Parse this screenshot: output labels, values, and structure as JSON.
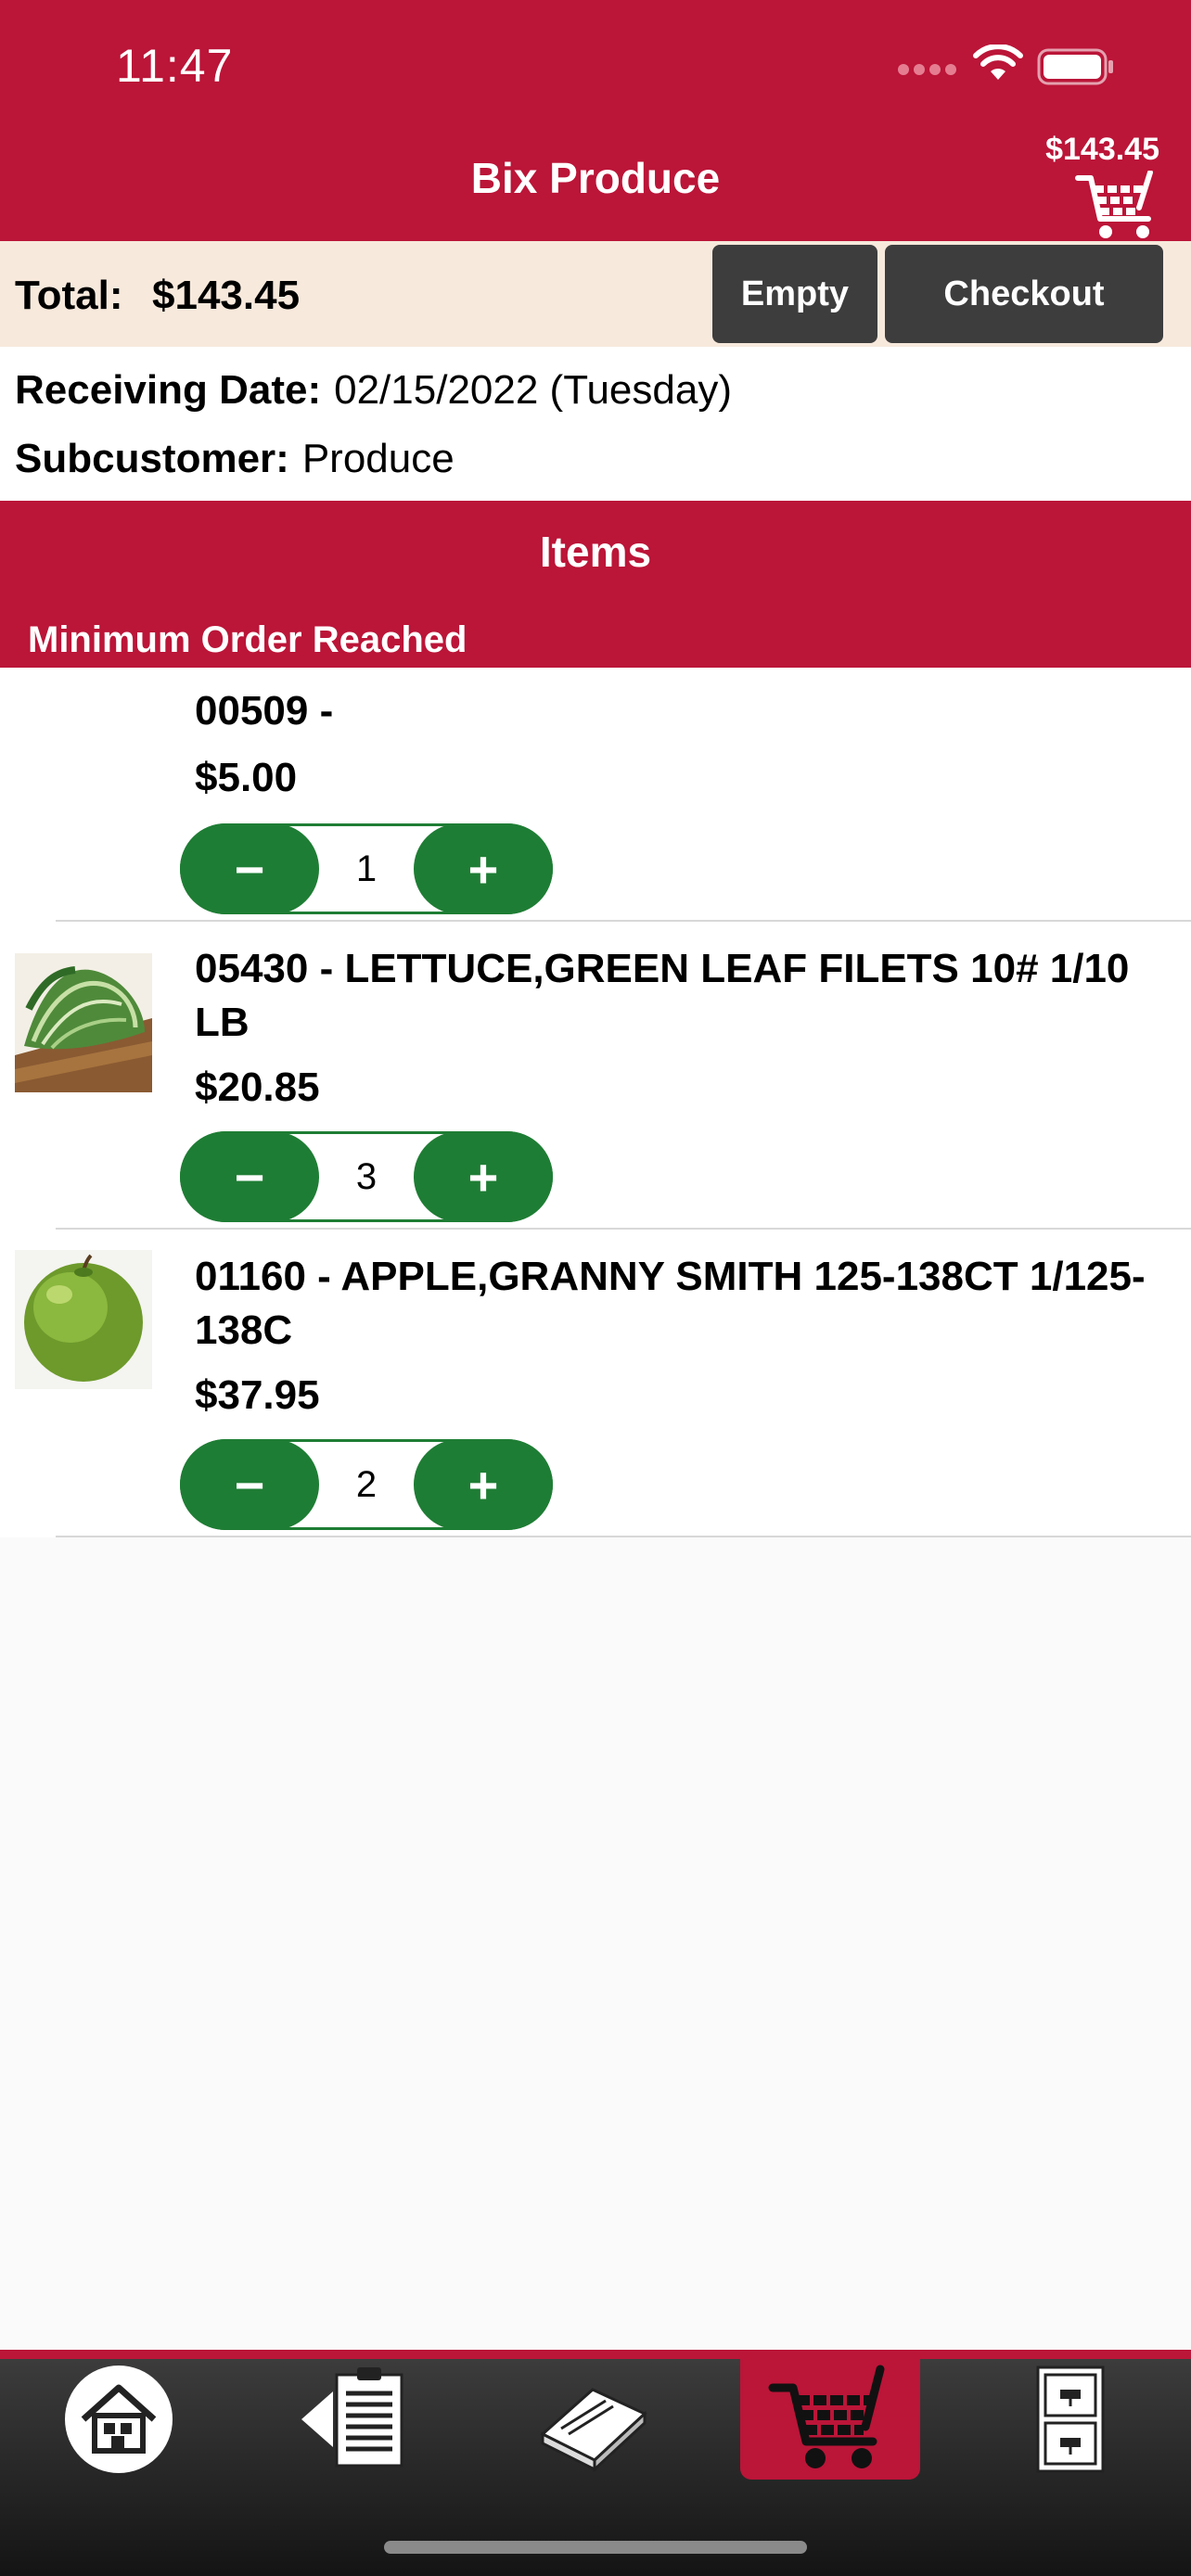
{
  "status_bar": {
    "time": "11:47"
  },
  "header": {
    "title": "Bix Produce",
    "cart_total": "$143.45"
  },
  "summary": {
    "total_label": "Total:",
    "total_value": "$143.45",
    "empty_label": "Empty",
    "checkout_label": "Checkout"
  },
  "info": {
    "receiving_label": "Receiving Date:",
    "receiving_value": "02/15/2022 (Tuesday)",
    "subcustomer_label": "Subcustomer:",
    "subcustomer_value": "Produce"
  },
  "items_section": {
    "title": "Items",
    "status": "Minimum Order Reached"
  },
  "items": [
    {
      "name": "00509 -",
      "price": "$5.00",
      "qty": "1",
      "image": "none"
    },
    {
      "name": "05430 - LETTUCE,GREEN LEAF FILETS 10# 1/10 LB",
      "price": "$20.85",
      "qty": "3",
      "image": "lettuce-photo"
    },
    {
      "name": "01160 - APPLE,GRANNY SMITH 125-138CT 1/125-138C",
      "price": "$37.95",
      "qty": "2",
      "image": "green-apple-photo"
    }
  ],
  "stepper": {
    "minus": "−",
    "plus": "+"
  },
  "tabbar": {
    "tabs": [
      "home-icon",
      "order-guide-icon",
      "catalog-book-icon",
      "cart-icon",
      "file-cabinet-icon"
    ],
    "active": "cart-icon"
  },
  "colors": {
    "brand": "#bb1538",
    "stepper_green": "#1e7d34",
    "button_dark": "#3d3d3d",
    "summary_bg": "#f7e9dc"
  }
}
